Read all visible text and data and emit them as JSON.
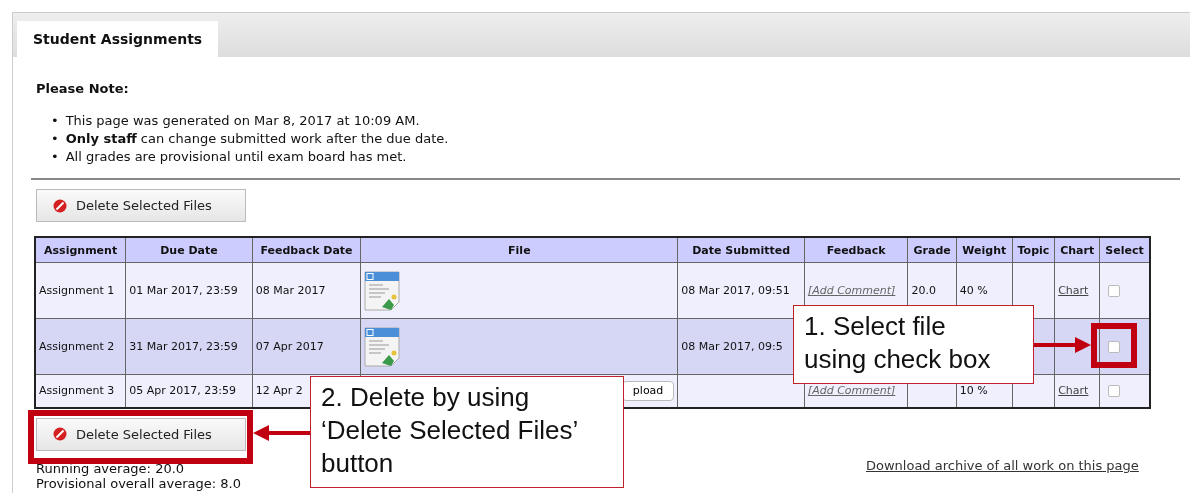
{
  "tab": {
    "label": "Student Assignments",
    "selected": true
  },
  "note": {
    "heading": "Please Note:",
    "marker": "•",
    "items": [
      "This page was generated on Mar 8, 2017 at 10:09 AM.",
      "**Only staff** can change submitted work after the due date.",
      "All grades are provisional until exam board has met."
    ]
  },
  "top_button": {
    "label": "Delete Selected Files"
  },
  "table": {
    "columns": [
      "Assignment",
      "Due Date",
      "Feedback Date",
      "File",
      "Date Submitted",
      "Feedback",
      "Grade",
      "Weight",
      "Topic",
      "Chart",
      "Select"
    ],
    "rows": [
      {
        "assignment": "Assignment 1",
        "due_date": "01 Mar 2017, 23:59",
        "feedback_date": "08 Mar 2017",
        "file": {
          "kind": "document"
        },
        "date_submitted": "08 Mar 2017, 09:51",
        "feedback": "[Add Comment]",
        "grade": "20.0",
        "weight": "40 %",
        "chart": "Chart",
        "checked": false
      },
      {
        "assignment": "Assignment 2",
        "due_date": "31 Mar 2017, 23:59",
        "feedback_date": "07 Apr 2017",
        "file": {
          "kind": "document"
        },
        "date_submitted": "08 Mar 2017, 09:5",
        "checked": false
      },
      {
        "assignment": "Assignment 3",
        "due_date": "05 Apr 2017, 23:59",
        "feedback_date": "12 Apr 2",
        "file": {
          "kind": "upload",
          "label": "pload"
        },
        "feedback": "[Add Comment]",
        "weight": "10 %",
        "chart": "Chart",
        "checked": false
      }
    ]
  },
  "bottom_button": {
    "label": "Delete Selected Files"
  },
  "summary": [
    "Running average: 20.0",
    "Provisional overall average: 8.0"
  ],
  "download_link": "Download archive of all work on this page",
  "callouts": [
    {
      "text": "1. Select file using check box"
    },
    {
      "text": "2. Delete by using ‘Delete Selected Files’ button"
    }
  ]
}
